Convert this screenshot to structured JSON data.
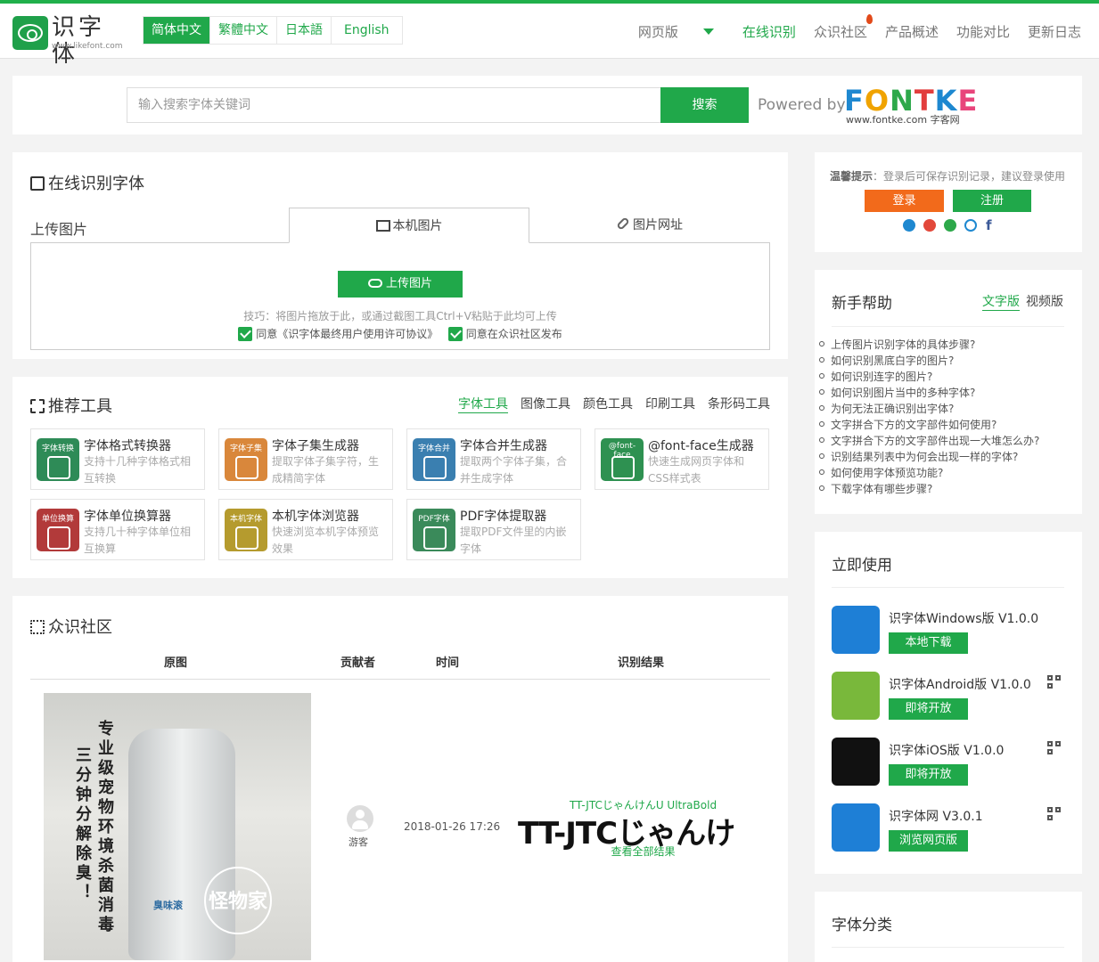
{
  "header": {
    "logo_text": "识字体",
    "logo_url_text": "www.likefont.com",
    "languages": [
      "简体中文",
      "繁體中文",
      "日本語",
      "English"
    ],
    "nav": [
      "网页版",
      "在线识别",
      "众识社区",
      "产品概述",
      "功能对比",
      "更新日志"
    ]
  },
  "search": {
    "placeholder": "输入搜索字体关键词",
    "button": "搜索",
    "powered_by": "Powered by",
    "fontke_logo": "FONTKE",
    "fontke_sub": "www.fontke.com 字客网"
  },
  "recognize": {
    "title": "在线识别字体",
    "upload_label": "上传图片",
    "tabs": [
      "本机图片",
      "图片网址"
    ],
    "upload_button": "上传图片",
    "tip": "技巧：将图片拖放于此，或通过截图工具Ctrl+V粘贴于此均可上传",
    "agree1": "同意《识字体最终用户使用许可协议》",
    "agree2": "同意在众识社区发布"
  },
  "tools": {
    "title": "推荐工具",
    "tabs": [
      "字体工具",
      "图像工具",
      "颜色工具",
      "印刷工具",
      "条形码工具"
    ],
    "items": [
      {
        "name": "字体格式转换器",
        "desc": "支持十几种字体格式相互转换",
        "icon_label": "字体转换",
        "color": "#2e8b57"
      },
      {
        "name": "字体子集生成器",
        "desc": "提取字体子集字符，生成精简字体",
        "icon_label": "字体子集",
        "color": "#d9873b"
      },
      {
        "name": "字体合并生成器",
        "desc": "提取两个字体子集，合并生成字体",
        "icon_label": "字体合并",
        "color": "#3a7fb0"
      },
      {
        "name": "@font-face生成器",
        "desc": "快速生成网页字体和CSS样式表",
        "icon_label": "@font-face",
        "color": "#2e9151"
      },
      {
        "name": "字体单位换算器",
        "desc": "支持几十种字体单位相互换算",
        "icon_label": "单位换算",
        "color": "#b23a3a"
      },
      {
        "name": "本机字体浏览器",
        "desc": "快速浏览本机字体预览效果",
        "icon_label": "本机字体",
        "color": "#b59b2e"
      },
      {
        "name": "PDF字体提取器",
        "desc": "提取PDF文件里的内嵌字体",
        "icon_label": "PDF字体",
        "color": "#3a8a5a"
      }
    ]
  },
  "community": {
    "title": "众识社区",
    "columns": [
      "原图",
      "贡献者",
      "时间",
      "识别结果"
    ],
    "row": {
      "photo_text_left": "三分钟分解除臭！",
      "photo_text_right": "专业级宠物环境杀菌消毒",
      "photo_brand": "臭味滚",
      "photo_stamp": "怪物家",
      "contributor": "游客",
      "time": "2018-01-26 17:26",
      "font_name": "TT-JTCじゃんけんU UltraBold",
      "preview": "TT-JTCじゃんけ",
      "view_all": "查看全部结果"
    }
  },
  "login": {
    "tip_label": "温馨提示",
    "tip": "：登录后可保存识别记录，建议登录使用",
    "login": "登录",
    "register": "注册"
  },
  "help": {
    "title": "新手帮助",
    "tabs": [
      "文字版",
      "视频版"
    ],
    "items": [
      "上传图片识别字体的具体步骤?",
      "如何识别黑底白字的图片?",
      "如何识别连字的图片?",
      "如何识别图片当中的多种字体?",
      "为何无法正确识别出字体?",
      "文字拼合下方的文字部件如何使用?",
      "文字拼合下方的文字部件出现一大堆怎么办?",
      "识别结果列表中为何会出现一样的字体?",
      "如何使用字体预览功能?",
      "下载字体有哪些步骤?"
    ]
  },
  "apps": {
    "title": "立即使用",
    "items": [
      {
        "name": "识字体Windows版 V1.0.0",
        "button": "本地下载",
        "icon": "windows-icon"
      },
      {
        "name": "识字体Android版 V1.0.0",
        "button": "即将开放",
        "icon": "android-icon"
      },
      {
        "name": "识字体iOS版 V1.0.0",
        "button": "即将开放",
        "icon": "apple-icon"
      },
      {
        "name": "识字体网 V3.0.1",
        "button": "浏览网页版",
        "icon": "ie-icon"
      }
    ]
  },
  "category": {
    "title": "字体分类"
  },
  "colors": {
    "accent": "#20a84a",
    "login": "#f26a1b"
  }
}
